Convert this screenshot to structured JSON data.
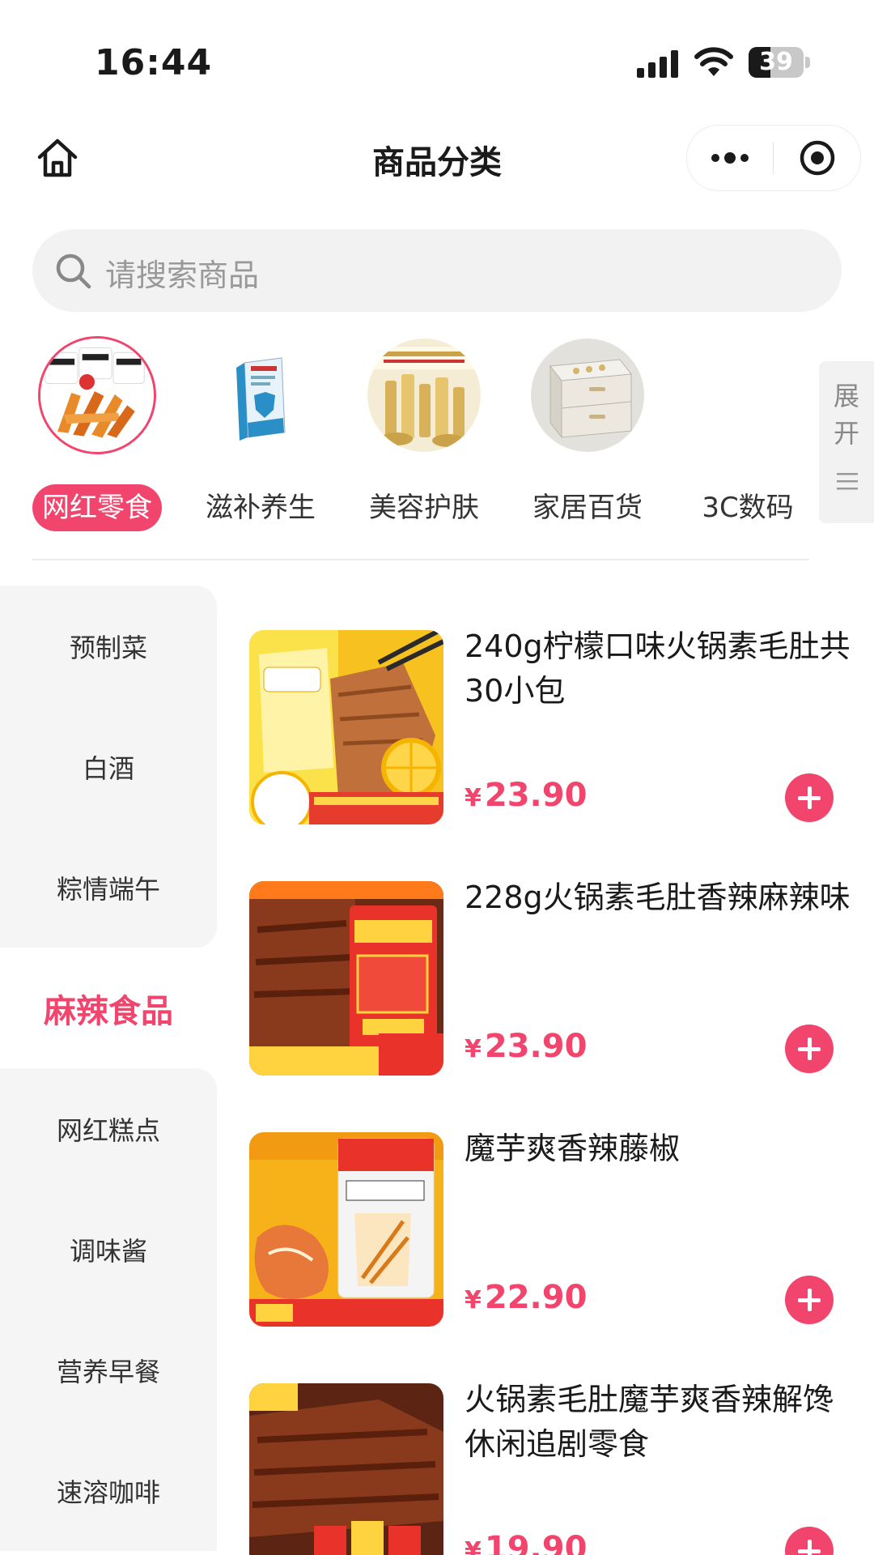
{
  "status_bar": {
    "time": "16:44",
    "battery": "39",
    "battery_level": 0.39
  },
  "nav": {
    "title": "商品分类"
  },
  "search": {
    "placeholder": "请搜索商品"
  },
  "categories": [
    {
      "label": "网红零食",
      "active": true
    },
    {
      "label": "滋补养生",
      "active": false
    },
    {
      "label": "美容护肤",
      "active": false
    },
    {
      "label": "家居百货",
      "active": false
    },
    {
      "label": "3C数码",
      "active": false
    }
  ],
  "expand": {
    "label_line1": "展",
    "label_line2": "开"
  },
  "sidebar": {
    "items": [
      {
        "label": "预制菜"
      },
      {
        "label": "白酒"
      },
      {
        "label": "粽情端午"
      },
      {
        "label": "麻辣食品",
        "active": true
      },
      {
        "label": "网红糕点"
      },
      {
        "label": "调味酱"
      },
      {
        "label": "营养早餐"
      },
      {
        "label": "速溶咖啡"
      }
    ]
  },
  "products": [
    {
      "title": "240g柠檬口味火锅素毛肚共30小包",
      "currency": "¥",
      "price": "23.90"
    },
    {
      "title": "228g火锅素毛肚香辣麻辣味",
      "currency": "¥",
      "price": "23.90"
    },
    {
      "title": "魔芋爽香辣藤椒",
      "currency": "¥",
      "price": "22.90"
    },
    {
      "title": "火锅素毛肚魔芋爽香辣解馋休闲追剧零食",
      "currency": "¥",
      "price": "19.90"
    }
  ],
  "colors": {
    "accent": "#f2456e",
    "sidebar_bg": "#f5f5f5",
    "search_bg": "#f2f2f2"
  }
}
